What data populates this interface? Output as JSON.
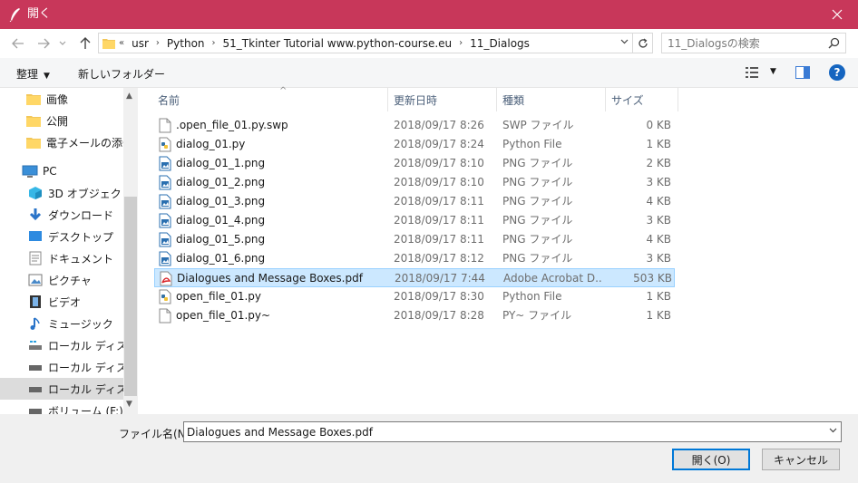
{
  "window": {
    "title": "開く"
  },
  "address": {
    "crumbs": [
      "usr",
      "Python",
      "51_Tkinter Tutorial www.python-course.eu",
      "11_Dialogs"
    ],
    "overflow": "«"
  },
  "search": {
    "placeholder": "11_Dialogsの検索"
  },
  "toolbar": {
    "organize": "整理",
    "new_folder": "新しいフォルダー",
    "help": "?"
  },
  "sidebar": {
    "items": [
      {
        "label": "画像",
        "icon": "folder-cloud-icon"
      },
      {
        "label": "公開",
        "icon": "folder-cloud-icon"
      },
      {
        "label": "電子メールの添付",
        "icon": "folder-cloud-icon"
      },
      {
        "label": "PC",
        "icon": "computer-icon"
      },
      {
        "label": "3D オブジェクト",
        "icon": "cube-3d-icon"
      },
      {
        "label": "ダウンロード",
        "icon": "download-icon"
      },
      {
        "label": "デスクトップ",
        "icon": "desktop-icon"
      },
      {
        "label": "ドキュメント",
        "icon": "document-icon"
      },
      {
        "label": "ピクチャ",
        "icon": "pictures-icon"
      },
      {
        "label": "ビデオ",
        "icon": "video-icon"
      },
      {
        "label": "ミュージック",
        "icon": "music-icon"
      },
      {
        "label": "ローカル ディスク (",
        "icon": "drive-windows-icon"
      },
      {
        "label": "ローカル ディスク (",
        "icon": "drive-icon"
      },
      {
        "label": "ローカル ディスク (",
        "icon": "drive-icon"
      },
      {
        "label": "ボリューム (F:)",
        "icon": "drive-icon"
      }
    ]
  },
  "columns": {
    "name": "名前",
    "date": "更新日時",
    "type": "種類",
    "size": "サイズ"
  },
  "files": [
    {
      "name": ".open_file_01.py.swp",
      "date": "2018/09/17 8:26",
      "type": "SWP ファイル",
      "size": "0 KB",
      "icon": "blank-file-icon"
    },
    {
      "name": "dialog_01.py",
      "date": "2018/09/17 8:24",
      "type": "Python File",
      "size": "1 KB",
      "icon": "python-file-icon"
    },
    {
      "name": "dialog_01_1.png",
      "date": "2018/09/17 8:10",
      "type": "PNG ファイル",
      "size": "2 KB",
      "icon": "image-file-icon"
    },
    {
      "name": "dialog_01_2.png",
      "date": "2018/09/17 8:10",
      "type": "PNG ファイル",
      "size": "3 KB",
      "icon": "image-file-icon"
    },
    {
      "name": "dialog_01_3.png",
      "date": "2018/09/17 8:11",
      "type": "PNG ファイル",
      "size": "4 KB",
      "icon": "image-file-icon"
    },
    {
      "name": "dialog_01_4.png",
      "date": "2018/09/17 8:11",
      "type": "PNG ファイル",
      "size": "3 KB",
      "icon": "image-file-icon"
    },
    {
      "name": "dialog_01_5.png",
      "date": "2018/09/17 8:11",
      "type": "PNG ファイル",
      "size": "4 KB",
      "icon": "image-file-icon"
    },
    {
      "name": "dialog_01_6.png",
      "date": "2018/09/17 8:12",
      "type": "PNG ファイル",
      "size": "3 KB",
      "icon": "image-file-icon"
    },
    {
      "name": "Dialogues and Message Boxes.pdf",
      "date": "2018/09/17 7:44",
      "type": "Adobe Acrobat D...",
      "size": "503 KB",
      "icon": "pdf-file-icon"
    },
    {
      "name": "open_file_01.py",
      "date": "2018/09/17 8:30",
      "type": "Python File",
      "size": "1 KB",
      "icon": "python-file-icon"
    },
    {
      "name": "open_file_01.py~",
      "date": "2018/09/17 8:28",
      "type": "PY~ ファイル",
      "size": "1 KB",
      "icon": "blank-file-icon"
    }
  ],
  "filename": {
    "label": "ファイル名(N):",
    "value": "Dialogues and Message Boxes.pdf"
  },
  "buttons": {
    "open": "開く(O)",
    "cancel": "キャンセル"
  },
  "colors": {
    "titlebar": "#c8375a",
    "selection": "#cce8ff",
    "accent": "#0078d7"
  }
}
